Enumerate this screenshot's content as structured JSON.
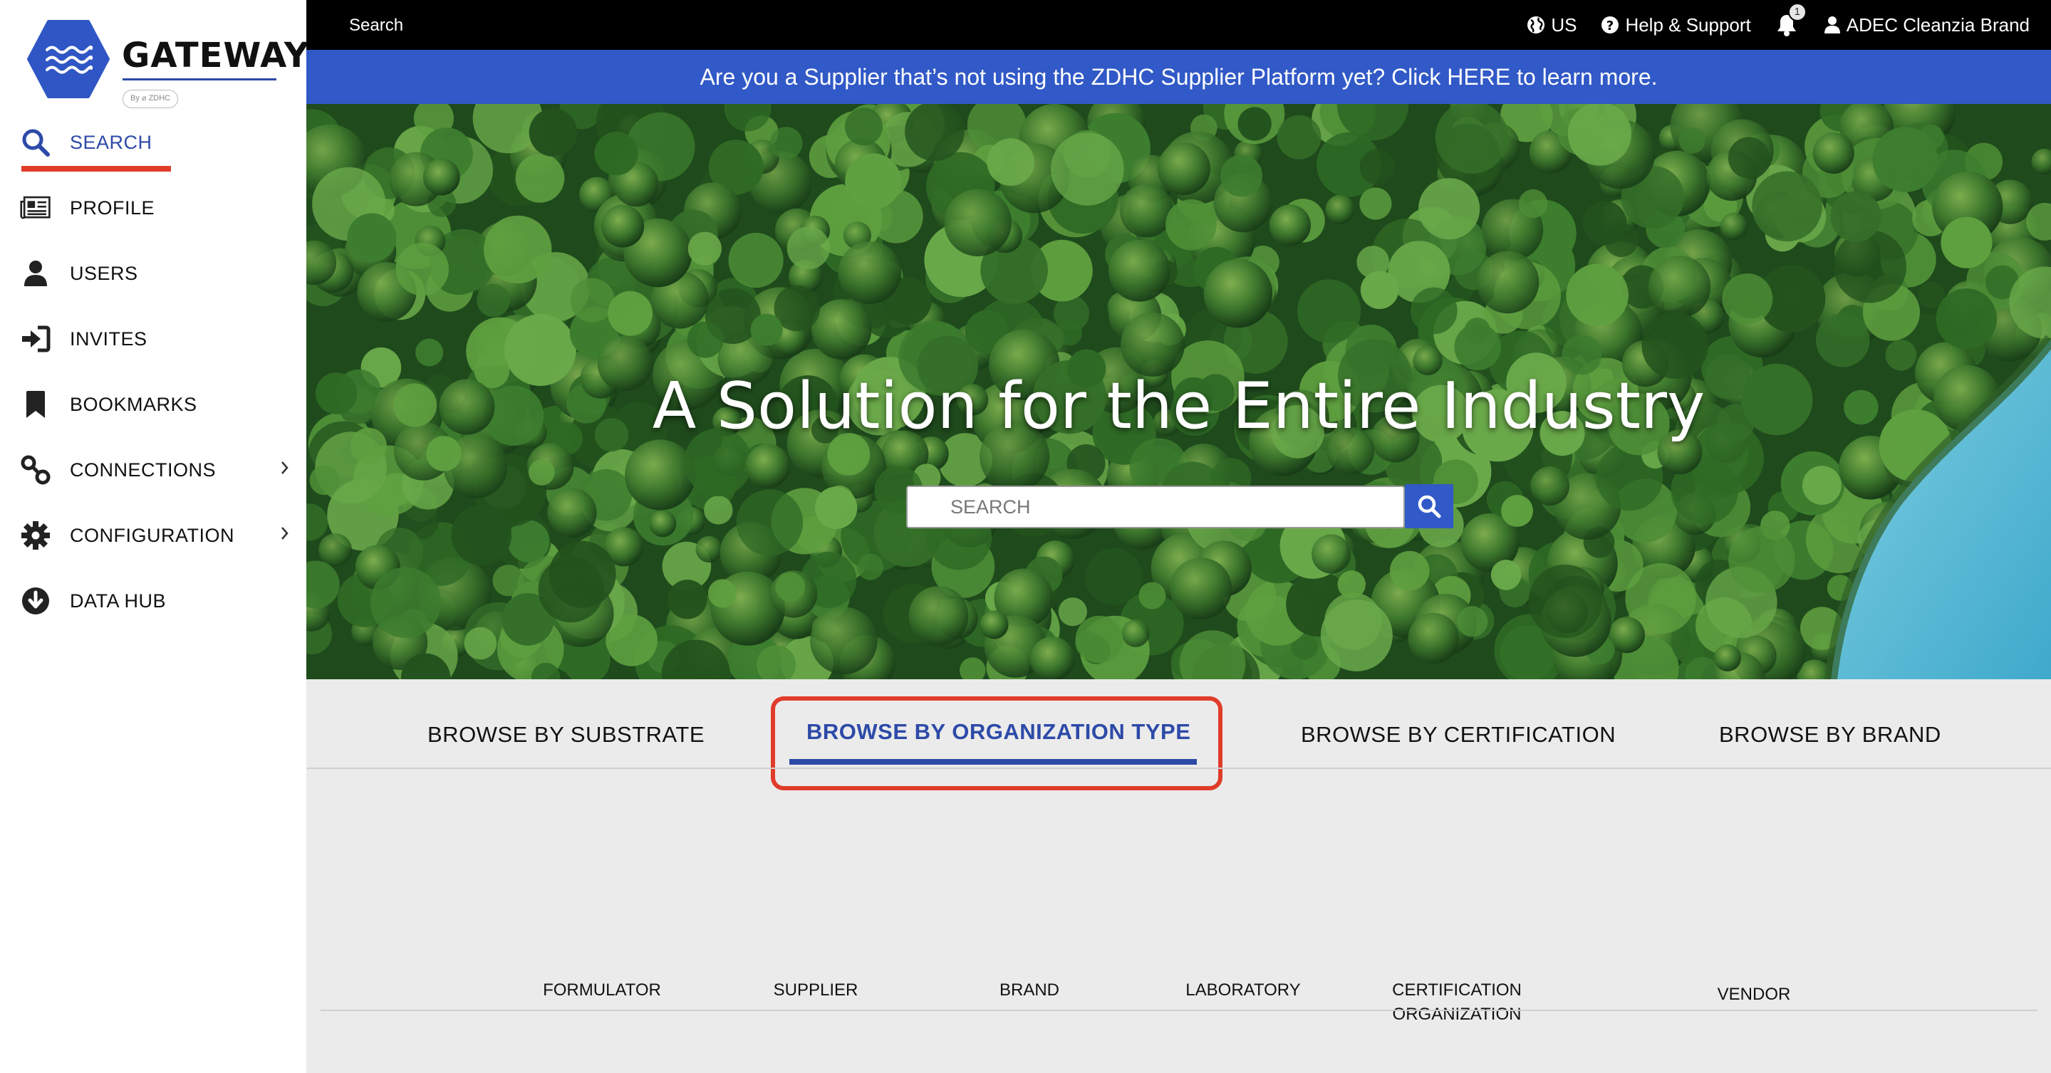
{
  "brand": {
    "name": "GATEWAY",
    "by": "By ⌀ ZDHC"
  },
  "sidebar": {
    "items": [
      {
        "label": "SEARCH",
        "icon": "search-icon",
        "active": true
      },
      {
        "label": "PROFILE",
        "icon": "newspaper-icon"
      },
      {
        "label": "USERS",
        "icon": "user-icon"
      },
      {
        "label": "INVITES",
        "icon": "sign-in-icon"
      },
      {
        "label": "BOOKMARKS",
        "icon": "bookmark-icon"
      },
      {
        "label": "CONNECTIONS",
        "icon": "link-icon",
        "expandable": true
      },
      {
        "label": "CONFIGURATION",
        "icon": "gear-icon",
        "expandable": true
      },
      {
        "label": "DATA HUB",
        "icon": "download-circle-icon"
      }
    ]
  },
  "topbar": {
    "search": "Search",
    "region": "US",
    "help": "Help & Support",
    "notifications": "1",
    "user": "ADEC Cleanzia Brand"
  },
  "banner": {
    "text": "Are you a Supplier that’s not using the ZDHC Supplier Platform yet? Click HERE to learn more."
  },
  "hero": {
    "title": "A Solution for the Entire Industry",
    "search_placeholder": "SEARCH"
  },
  "browse": {
    "tabs": [
      {
        "label": "BROWSE BY SUBSTRATE"
      },
      {
        "label": "BROWSE BY ORGANIZATION TYPE",
        "active": true
      },
      {
        "label": "BROWSE BY CERTIFICATION"
      },
      {
        "label": "BROWSE BY BRAND"
      }
    ],
    "org_types": [
      {
        "label": "FORMULATOR"
      },
      {
        "label": "SUPPLIER"
      },
      {
        "label": "BRAND"
      },
      {
        "label": "LABORATORY"
      },
      {
        "label": "CERTIFICATION ORGANIZATION",
        "line1": "CERTIFICATION",
        "line2": "ORGANIZATION"
      },
      {
        "label": "VENDOR"
      }
    ]
  },
  "colors": {
    "accent_blue": "#3159c7",
    "active_blue": "#2d4aa8",
    "highlight_red": "#e03c2a",
    "topbar_bg": "#000000",
    "browse_bg": "#ebebeb"
  }
}
